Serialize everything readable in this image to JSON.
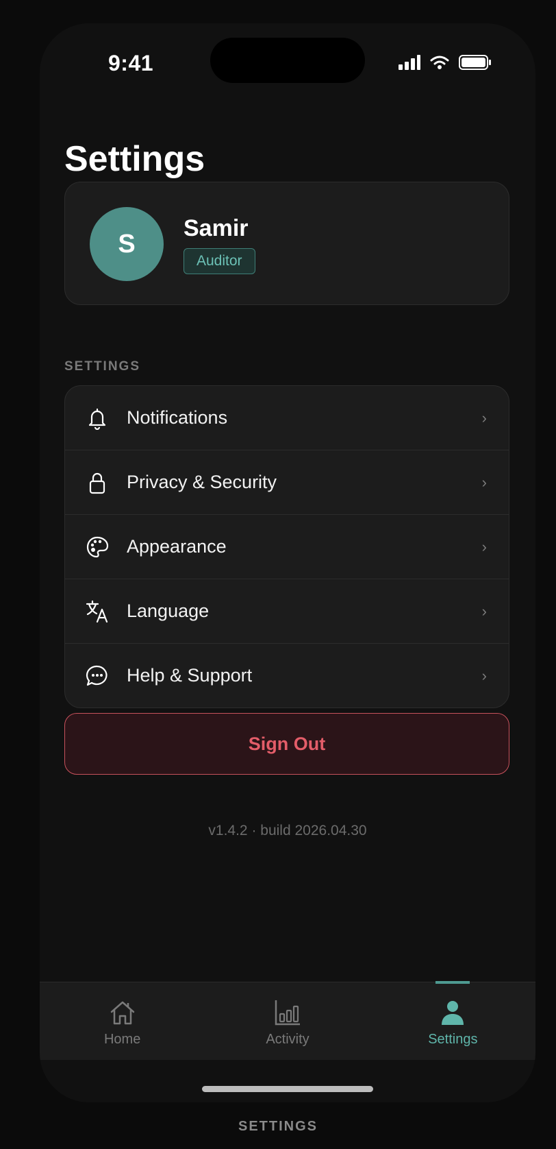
{
  "status_bar": {
    "time": "9:41",
    "icons": [
      "cellular-signal-icon",
      "wifi-icon",
      "battery-icon"
    ]
  },
  "page": {
    "title": "Settings"
  },
  "profile": {
    "avatar_initial": "S",
    "name": "Samir",
    "role": "Auditor"
  },
  "settings": {
    "section_title": "SETTINGS",
    "items": [
      {
        "label": "Notifications",
        "icon": "bell-icon"
      },
      {
        "label": "Privacy & Security",
        "icon": "lock-icon"
      },
      {
        "label": "Appearance",
        "icon": "palette-icon"
      },
      {
        "label": "Language",
        "icon": "translate-icon"
      },
      {
        "label": "Help & Support",
        "icon": "chat-bubble-icon"
      }
    ],
    "chevron": "›"
  },
  "sign_out": {
    "label": "Sign Out"
  },
  "version": {
    "text": "v1.4.2 · build 2026.04.30"
  },
  "tab_bar": {
    "tabs": [
      {
        "label": "Home",
        "icon": "home-icon",
        "active": false
      },
      {
        "label": "Activity",
        "icon": "bar-chart-icon",
        "active": false
      },
      {
        "label": "Settings",
        "icon": "person-icon",
        "active": true
      }
    ]
  },
  "caption": {
    "text": "SETTINGS"
  },
  "colors": {
    "background": "#111111",
    "card": "#1c1c1c",
    "accent": "#5fb5aa",
    "avatar": "#4e8f88",
    "danger": "#e35d69"
  }
}
